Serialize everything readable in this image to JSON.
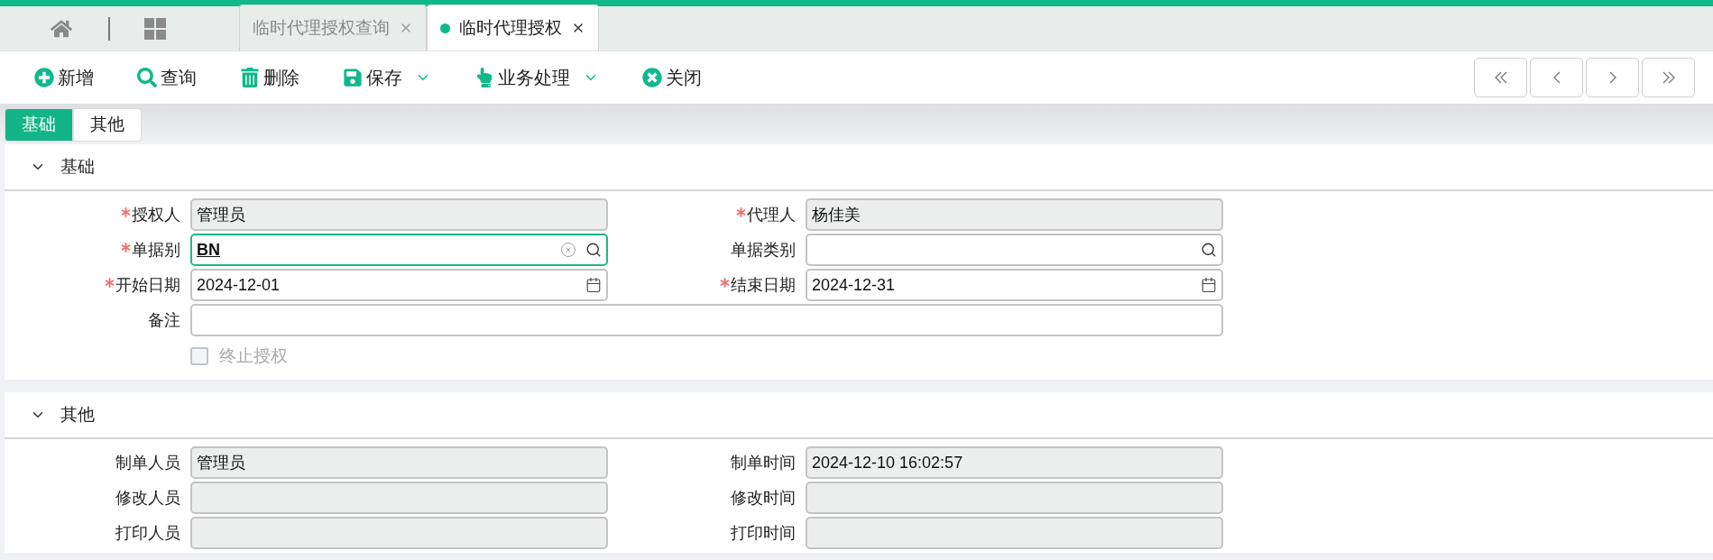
{
  "nav_tabs": [
    {
      "label": "临时代理授权查询",
      "selected": false
    },
    {
      "label": "临时代理授权",
      "selected": true
    }
  ],
  "toolbar": [
    {
      "label": "新增",
      "kind": "add",
      "dropdown": false
    },
    {
      "label": "查询",
      "kind": "search",
      "dropdown": false
    },
    {
      "label": "删除",
      "kind": "delete",
      "dropdown": false
    },
    {
      "label": "保存",
      "kind": "save",
      "dropdown": true
    },
    {
      "label": "业务处理",
      "kind": "process",
      "dropdown": true
    },
    {
      "label": "关闭",
      "kind": "close",
      "dropdown": false
    }
  ],
  "sub_tabs": [
    {
      "label": "基础",
      "selected": true
    },
    {
      "label": "其他",
      "selected": false
    }
  ],
  "sections": [
    {
      "title": "基础",
      "expanded": true,
      "fields": [
        {
          "label": "授权人",
          "required": true,
          "kind": "readonly",
          "value": "管理员",
          "focused": false
        },
        {
          "label": "代理人",
          "required": true,
          "kind": "readonly",
          "value": "杨佳美",
          "focused": false
        },
        {
          "label": "单据别",
          "required": true,
          "kind": "lookup",
          "value": "BN",
          "focused": true
        },
        {
          "label": "单据类别",
          "required": false,
          "kind": "lookup",
          "focused": false
        },
        {
          "label": "开始日期",
          "required": true,
          "kind": "date",
          "value": "2024-12-01",
          "focused": false
        },
        {
          "label": "结束日期",
          "required": true,
          "kind": "date",
          "value": "2024-12-31",
          "focused": false
        },
        {
          "label": "备注",
          "required": false,
          "kind": "wide",
          "focused": false
        }
      ],
      "checkbox": {
        "label": "终止授权",
        "checked": false,
        "disabled": true
      }
    },
    {
      "title": "其他",
      "expanded": true,
      "fields": [
        {
          "label": "制单人员",
          "required": false,
          "kind": "readonly",
          "value": "管理员",
          "focused": false
        },
        {
          "label": "制单时间",
          "required": false,
          "kind": "readonly",
          "value": "2024-12-10 16:02:57",
          "focused": false
        },
        {
          "label": "修改人员",
          "required": false,
          "kind": "readonly",
          "focused": false
        },
        {
          "label": "修改时间",
          "required": false,
          "kind": "readonly",
          "focused": false
        },
        {
          "label": "打印人员",
          "required": false,
          "kind": "readonly",
          "focused": false
        },
        {
          "label": "打印时间",
          "required": false,
          "kind": "readonly",
          "focused": false
        }
      ]
    }
  ]
}
